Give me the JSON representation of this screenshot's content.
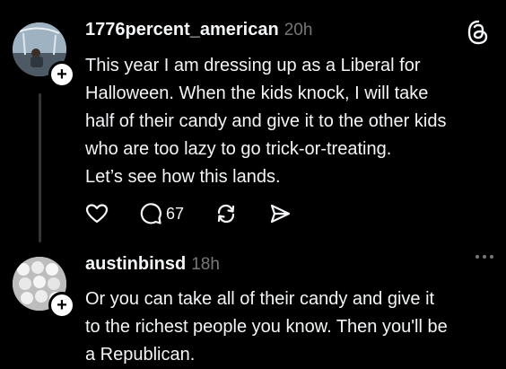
{
  "post1": {
    "username": "1776percent_american",
    "time": "20h",
    "lines": [
      "This year I am dressing up as a Liberal for",
      "Halloween. When the kids knock, I will take",
      "half of their candy and give it to the other kids",
      "who are too lazy to go trick-or-treating.",
      "Let’s see how this lands."
    ],
    "reply_count": "67",
    "icons": [
      "heart-icon",
      "comment-icon",
      "repost-icon",
      "share-icon"
    ]
  },
  "post2": {
    "username": "austinbinsd",
    "time": "18h",
    "lines": [
      "Or you can take all of their candy and give it",
      "to the richest people you know. Then you'll be",
      "a Republican."
    ]
  },
  "plus_symbol": "+",
  "colors": {
    "background": "#000000",
    "text": "#f3f5f7",
    "muted": "#777777"
  }
}
